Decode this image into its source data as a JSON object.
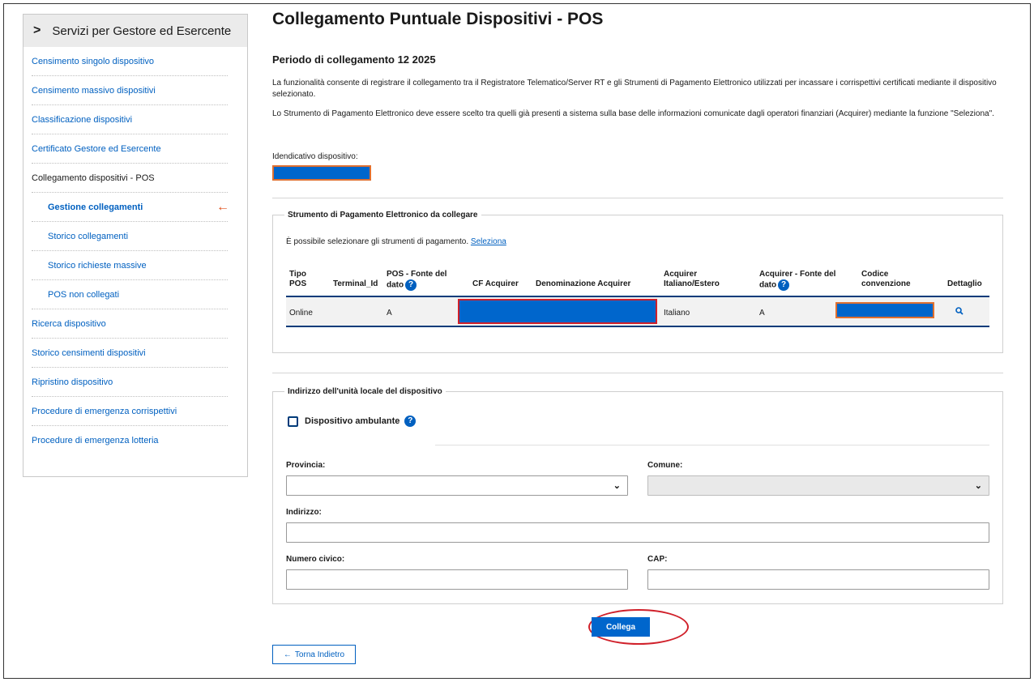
{
  "sidebar": {
    "title": "Servizi per Gestore ed Esercente",
    "items": [
      {
        "label": "Censimento singolo dispositivo"
      },
      {
        "label": "Censimento massivo dispositivi"
      },
      {
        "label": "Classificazione dispositivi"
      },
      {
        "label": "Certificato Gestore ed Esercente"
      },
      {
        "label": "Collegamento dispositivi - POS"
      },
      {
        "label": "Gestione collegamenti"
      },
      {
        "label": "Storico collegamenti"
      },
      {
        "label": "Storico richieste massive"
      },
      {
        "label": "POS non collegati"
      },
      {
        "label": "Ricerca dispositivo"
      },
      {
        "label": "Storico censimenti dispositivi"
      },
      {
        "label": "Ripristino dispositivo"
      },
      {
        "label": "Procedure di emergenza corrispettivi"
      },
      {
        "label": "Procedure di emergenza lotteria"
      }
    ],
    "active_arrow": "←"
  },
  "main": {
    "title": "Collegamento Puntuale Dispositivi - POS",
    "period": "Periodo di collegamento 12 2025",
    "desc1": "La funzionalità consente di registrare il collegamento tra il Registratore Telematico/Server RT e gli Strumenti di Pagamento Elettronico utilizzati per incassare i corrispettivi certificati mediante il dispositivo selezionato.",
    "desc2": "Lo Strumento di Pagamento Elettronico deve essere scelto tra quelli già presenti a sistema sulla base delle informazioni comunicate dagli operatori finanziari (Acquirer) mediante la funzione \"Seleziona\".",
    "id_label": "Idendicativo dispositivo:"
  },
  "payment": {
    "legend": "Strumento di Pagamento Elettronico da collegare",
    "hint": "È possibile selezionare gli strumenti di pagamento.",
    "hint_link": "Seleziona",
    "headers": {
      "tipo_pos_1": "Tipo",
      "tipo_pos_2": "POS",
      "terminal": "Terminal_Id",
      "fonte_1": "POS - Fonte del",
      "fonte_2": "dato",
      "cf": "CF Acquirer",
      "denominazione": "Denominazione Acquirer",
      "acq_it_1": "Acquirer",
      "acq_it_2": "Italiano/Estero",
      "acq_fonte_1": "Acquirer - Fonte del",
      "acq_fonte_2": "dato",
      "codice_1": "Codice",
      "codice_2": "convenzione",
      "dettaglio": "Dettaglio"
    },
    "row": {
      "tipo": "Online",
      "fonte": "A",
      "acq_it": "Italiano",
      "acq_fonte": "A"
    },
    "help_glyph": "?"
  },
  "address": {
    "legend": "Indirizzo dell'unità locale del dispositivo",
    "ambulante": "Dispositivo ambulante",
    "provincia": "Provincia:",
    "comune": "Comune:",
    "indirizzo": "Indirizzo:",
    "civico": "Numero civico:",
    "cap": "CAP:"
  },
  "actions": {
    "collega": "Collega",
    "back": "Torna Indietro"
  }
}
